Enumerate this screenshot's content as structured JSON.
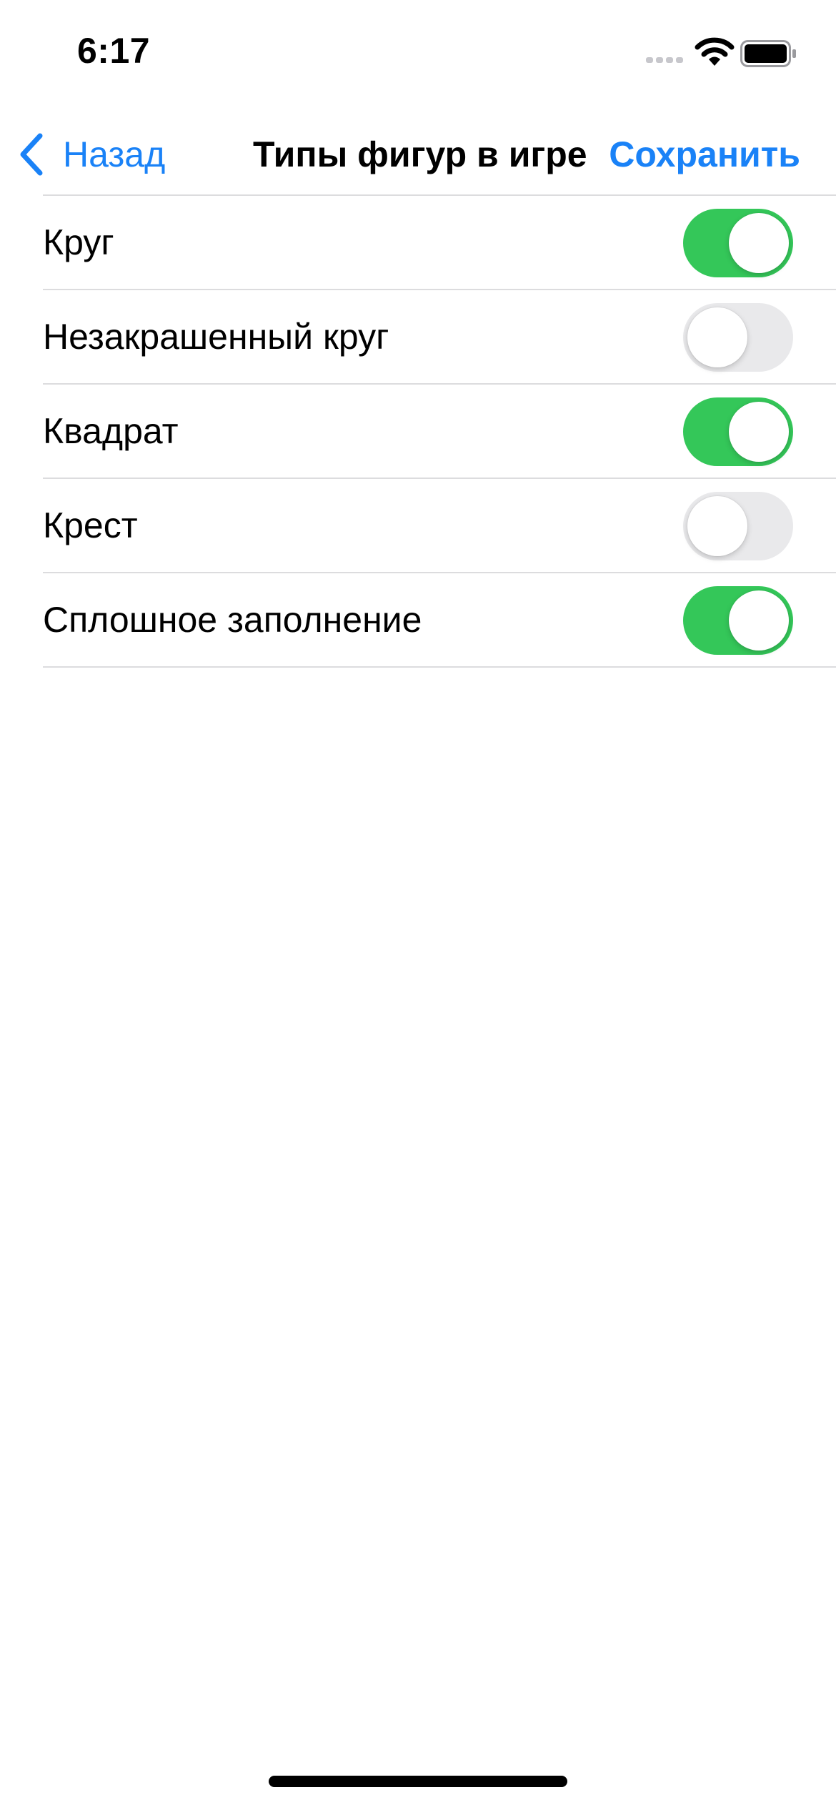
{
  "status_bar": {
    "time": "6:17",
    "icons": [
      "signal-icon",
      "wifi-icon",
      "battery-icon"
    ]
  },
  "nav": {
    "back_label": "Назад",
    "title": "Типы фигур в игре",
    "save_label": "Сохранить",
    "accent_color": "#1a82f7"
  },
  "settings": {
    "items": [
      {
        "label": "Круг",
        "enabled": true
      },
      {
        "label": "Незакрашенный круг",
        "enabled": false
      },
      {
        "label": "Квадрат",
        "enabled": true
      },
      {
        "label": "Крест",
        "enabled": false
      },
      {
        "label": "Сплошное заполнение",
        "enabled": true
      }
    ],
    "toggle_on_color": "#34c759",
    "toggle_off_color": "#e9e9eb"
  }
}
